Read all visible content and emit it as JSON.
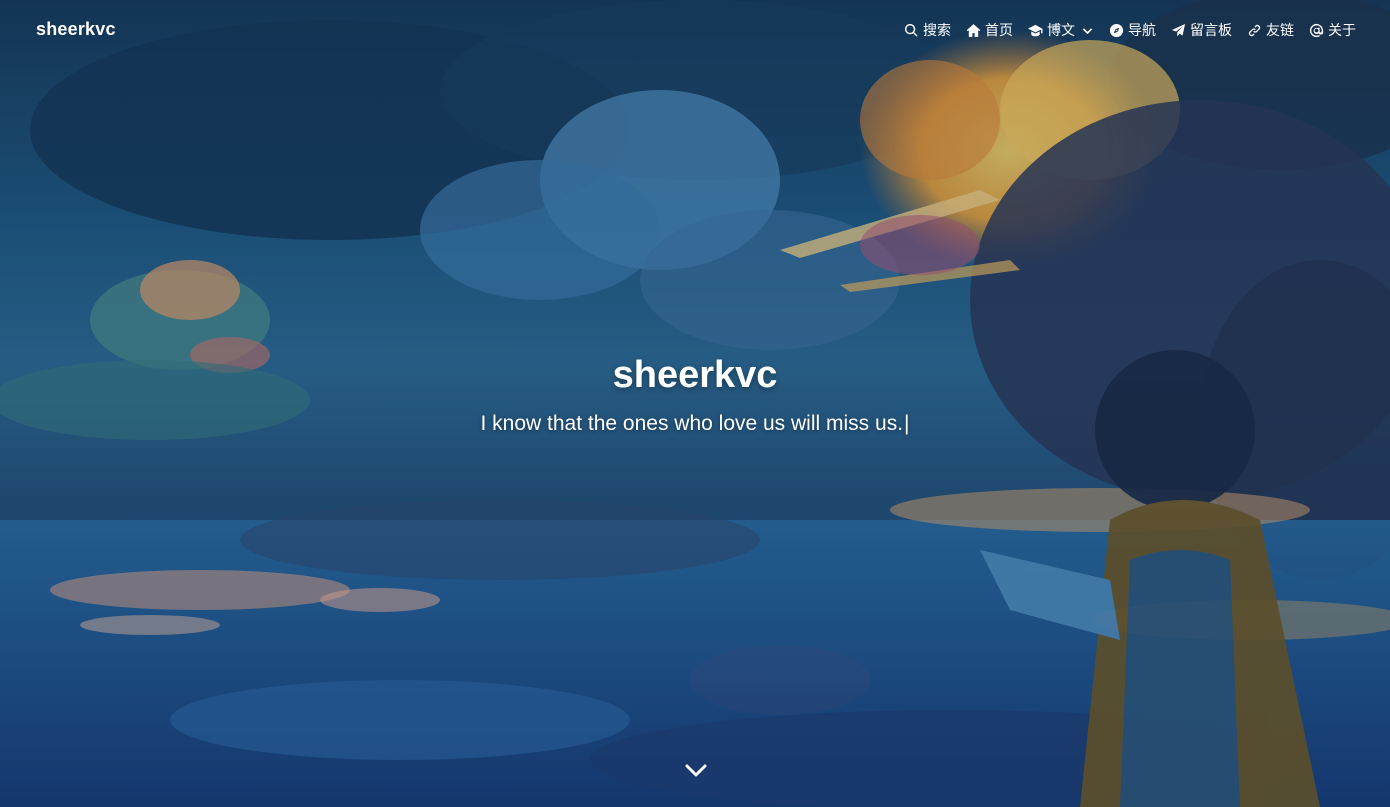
{
  "navbar": {
    "brand": "sheerkvc",
    "items": [
      {
        "label": "搜索",
        "icon": "search-icon"
      },
      {
        "label": "首页",
        "icon": "home-icon"
      },
      {
        "label": "博文",
        "icon": "graduation-cap-icon",
        "dropdown": true
      },
      {
        "label": "导航",
        "icon": "compass-icon"
      },
      {
        "label": "留言板",
        "icon": "paper-plane-icon"
      },
      {
        "label": "友链",
        "icon": "link-icon"
      },
      {
        "label": "关于",
        "icon": "at-icon"
      }
    ]
  },
  "hero": {
    "title": "sheerkvc",
    "subtitle": "I know that the ones who love us will miss us.",
    "cursor": "|"
  },
  "colors": {
    "text": "#ffffff",
    "sky_top": "#173a5c",
    "sky_mid": "#2d6b96",
    "sky_bottom": "#15306a",
    "cloud_warm": "#f0b34a"
  }
}
